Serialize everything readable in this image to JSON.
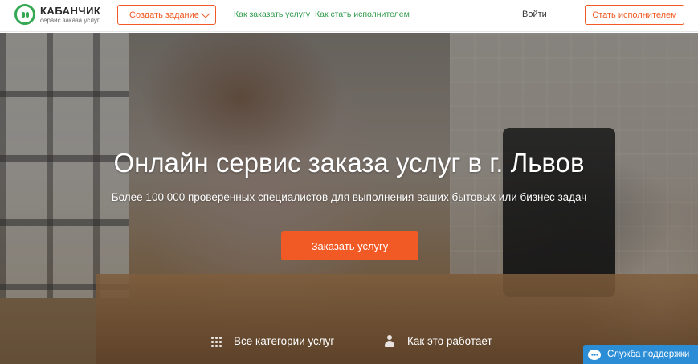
{
  "header": {
    "logo_name": "КАБАНЧИК",
    "logo_tagline": "сервис заказа услуг",
    "create_task_label": "Создать задание",
    "nav_links": [
      "Как заказать услугу",
      "Как стать исполнителем"
    ],
    "login_label": "Войти",
    "become_performer_label": "Стать исполнителем"
  },
  "hero": {
    "title": "Онлайн сервис заказа услуг в г. Львов",
    "subtitle": "Более 100 000 проверенных специалистов для выполнения ваших бытовых или бизнес задач",
    "order_button_label": "Заказать услугу",
    "links": [
      {
        "label": "Все категории услуг",
        "icon": "grid-icon"
      },
      {
        "label": "Как это работает",
        "icon": "user-icon"
      }
    ]
  },
  "support": {
    "label": "Служба поддержки",
    "icon": "chat-icon"
  },
  "colors": {
    "accent": "#f15a24",
    "brand_green": "#34a853",
    "link_green": "#2e9a4b",
    "support_blue": "#2b8dd6"
  }
}
